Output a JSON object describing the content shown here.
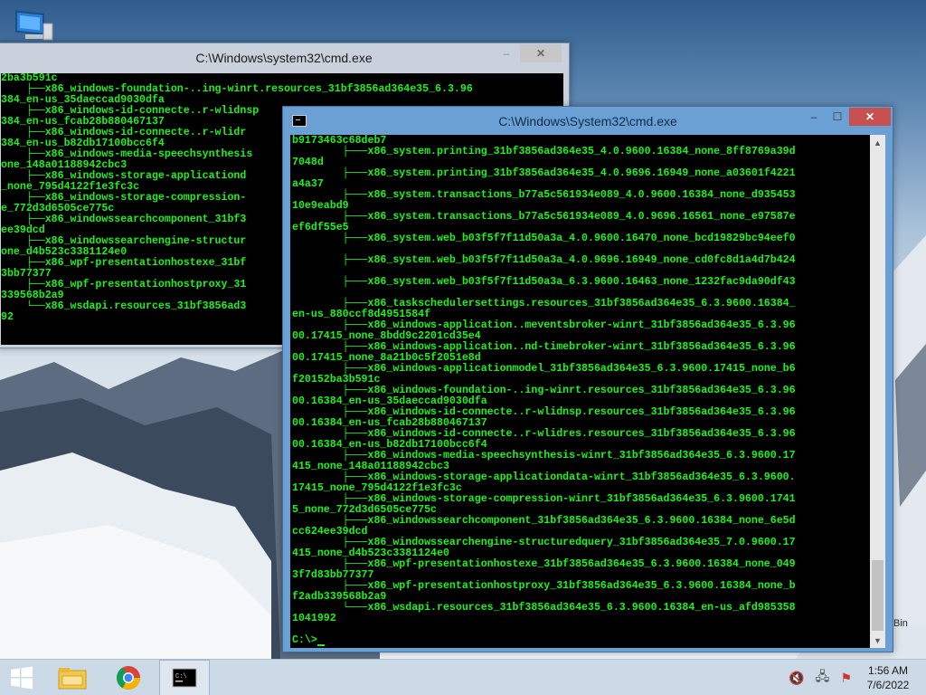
{
  "desktop": {
    "recycle_bin_label": "Bin"
  },
  "back_window": {
    "title": "C:\\Windows\\system32\\cmd.exe",
    "lines": [
      "2ba3b591c",
      "    ├──x86_windows-foundation-..ing-winrt.resources_31bf3856ad364e35_6.3.96",
      "384_en-us_35daeccad9030dfa",
      "    ├──x86_windows-id-connecte..r-wlidnsp",
      "384_en-us_fcab28b880467137",
      "    ├──x86_windows-id-connecte..r-wlidr",
      "384_en-us_b82db17100bcc6f4",
      "    ├──x86_windows-media-speechsynthesis",
      "one_148a01188942cbc3",
      "    ├──x86_windows-storage-applicationd",
      "_none_795d4122f1e3fc3c",
      "    ├──x86_windows-storage-compression-",
      "e_772d3d6505ce775c",
      "    ├──x86_windowssearchcomponent_31bf3",
      "ee39dcd",
      "    ├──x86_windowssearchengine-structur",
      "one_d4b523c3381124e0",
      "    ├──x86_wpf-presentationhostexe_31bf",
      "3bb77377",
      "    ├──x86_wpf-presentationhostproxy_31",
      "339568b2a9",
      "    └──x86_wsdapi.resources_31bf3856ad3",
      "92"
    ]
  },
  "front_window": {
    "title": "C:\\Windows\\System32\\cmd.exe",
    "lines": [
      "b9173463c68deb7",
      "        ├───x86_system.printing_31bf3856ad364e35_4.0.9600.16384_none_8ff8769a39d",
      "7048d",
      "        ├───x86_system.printing_31bf3856ad364e35_4.0.9696.16949_none_a03601f4221",
      "a4a37",
      "        ├───x86_system.transactions_b77a5c561934e089_4.0.9600.16384_none_d935453",
      "10e9eabd9",
      "        ├───x86_system.transactions_b77a5c561934e089_4.0.9696.16561_none_e97587e",
      "ef6df55e5",
      "        ├───x86_system.web_b03f5f7f11d50a3a_4.0.9600.16470_none_bcd19829bc94eef0",
      "",
      "        ├───x86_system.web_b03f5f7f11d50a3a_4.0.9696.16949_none_cd0fc8d1a4d7b424",
      "",
      "        ├───x86_system.web_b03f5f7f11d50a3a_6.3.9600.16463_none_1232fac9da90df43",
      "",
      "        ├───x86_taskschedulersettings.resources_31bf3856ad364e35_6.3.9600.16384_",
      "en-us_880ccf8d4951584f",
      "        ├───x86_windows-application..meventsbroker-winrt_31bf3856ad364e35_6.3.96",
      "00.17415_none_8bdd9c2201cd35e4",
      "        ├───x86_windows-application..nd-timebroker-winrt_31bf3856ad364e35_6.3.96",
      "00.17415_none_8a21b0c5f2051e8d",
      "        ├───x86_windows-applicationmodel_31bf3856ad364e35_6.3.9600.17415_none_b6",
      "f20152ba3b591c",
      "        ├───x86_windows-foundation-..ing-winrt.resources_31bf3856ad364e35_6.3.96",
      "00.16384_en-us_35daeccad9030dfa",
      "        ├───x86_windows-id-connecte..r-wlidnsp.resources_31bf3856ad364e35_6.3.96",
      "00.16384_en-us_fcab28b880467137",
      "        ├───x86_windows-id-connecte..r-wlidres.resources_31bf3856ad364e35_6.3.96",
      "00.16384_en-us_b82db17100bcc6f4",
      "        ├───x86_windows-media-speechsynthesis-winrt_31bf3856ad364e35_6.3.9600.17",
      "415_none_148a01188942cbc3",
      "        ├───x86_windows-storage-applicationdata-winrt_31bf3856ad364e35_6.3.9600.",
      "17415_none_795d4122f1e3fc3c",
      "        ├───x86_windows-storage-compression-winrt_31bf3856ad364e35_6.3.9600.1741",
      "5_none_772d3d6505ce775c",
      "        ├───x86_windowssearchcomponent_31bf3856ad364e35_6.3.9600.16384_none_6e5d",
      "cc624ee39dcd",
      "        ├───x86_windowssearchengine-structuredquery_31bf3856ad364e35_7.0.9600.17",
      "415_none_d4b523c3381124e0",
      "        ├───x86_wpf-presentationhostexe_31bf3856ad364e35_6.3.9600.16384_none_049",
      "3f7d83bb77377",
      "        ├───x86_wpf-presentationhostproxy_31bf3856ad364e35_6.3.9600.16384_none_b",
      "f2adb339568b2a9",
      "        └───x86_wsdapi.resources_31bf3856ad364e35_6.3.9600.16384_en-us_afd985358",
      "1041992",
      "",
      "C:\\>"
    ]
  },
  "taskbar": {
    "clock_time": "1:56 AM",
    "clock_date": "7/6/2022"
  }
}
